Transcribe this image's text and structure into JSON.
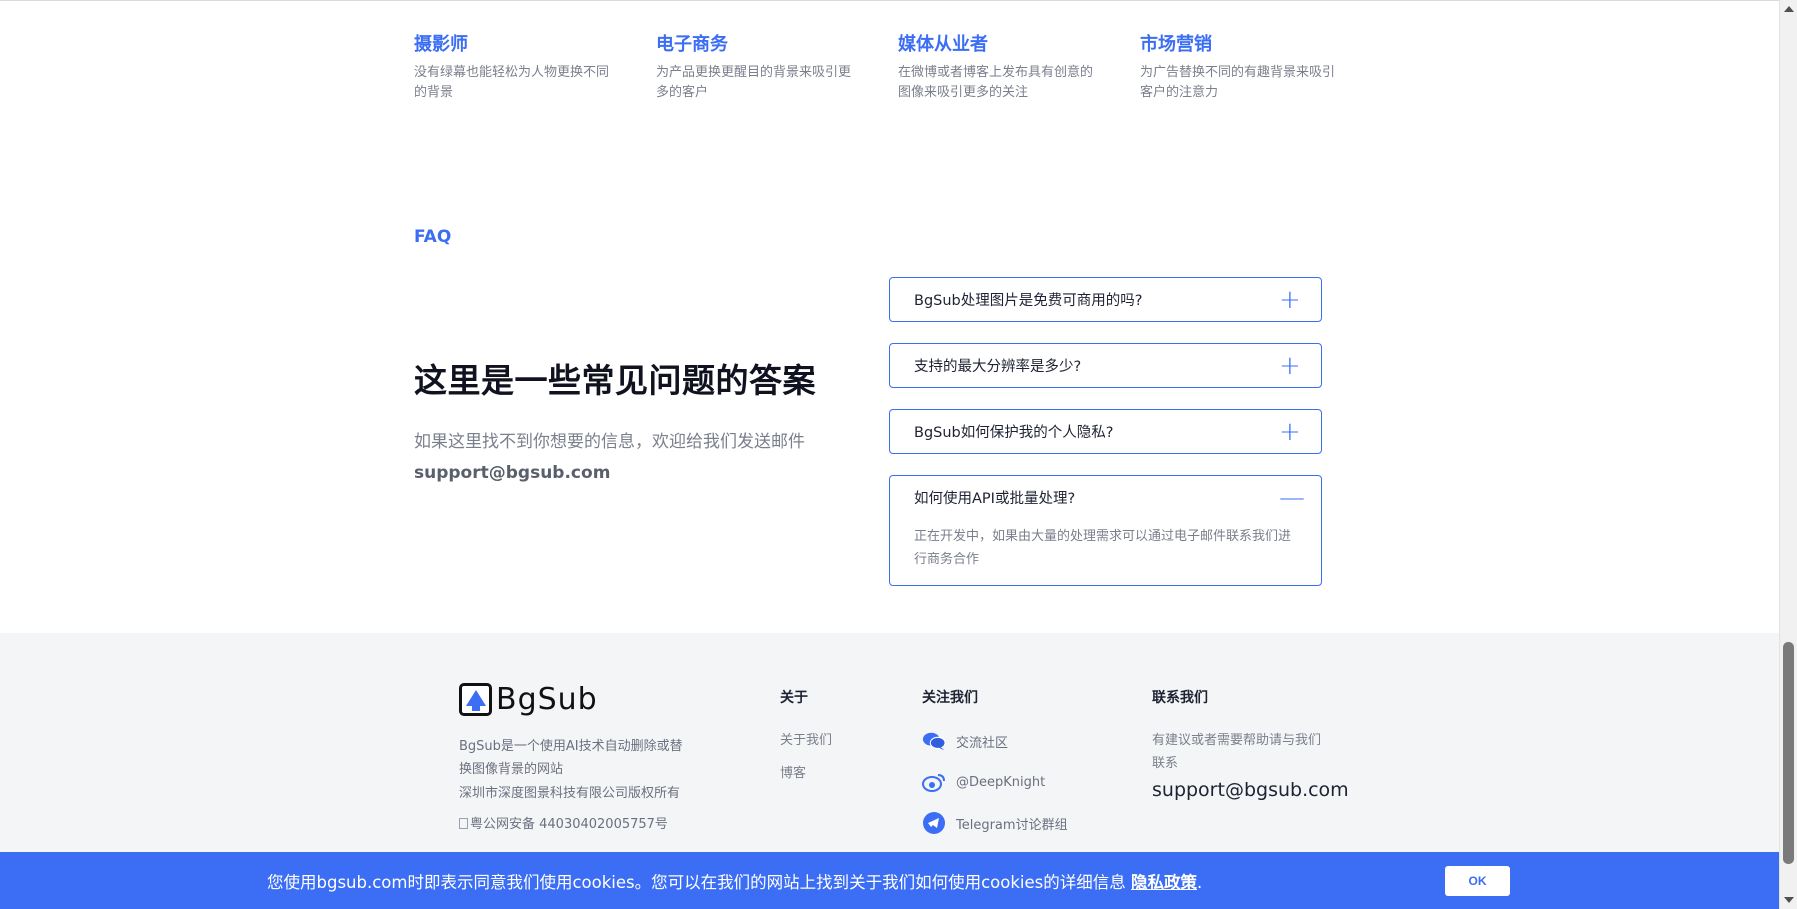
{
  "usecases": [
    {
      "title": "摄影师",
      "desc": "没有绿幕也能轻松为人物更换不同的背景"
    },
    {
      "title": "电子商务",
      "desc": "为产品更换更醒目的背景来吸引更多的客户"
    },
    {
      "title": "媒体从业者",
      "desc": "在微博或者博客上发布具有创意的图像来吸引更多的关注"
    },
    {
      "title": "市场营销",
      "desc": "为广告替换不同的有趣背景来吸引客户的注意力"
    }
  ],
  "faq": {
    "tag": "FAQ",
    "heading": "这里是一些常见问题的答案",
    "sub": "如果这里找不到你想要的信息，欢迎给我们发送邮件",
    "email": "support@bgsub.com",
    "items": [
      {
        "q": "BgSub处理图片是免费可商用的吗?",
        "toggle": "+",
        "expanded": false
      },
      {
        "q": "支持的最大分辨率是多少?",
        "toggle": "+",
        "expanded": false
      },
      {
        "q": "BgSub如何保护我的个人隐私?",
        "toggle": "+",
        "expanded": false
      },
      {
        "q": "如何使用API或批量处理?",
        "toggle": "—",
        "expanded": true,
        "a": "正在开发中，如果由大量的处理需求可以通过电子邮件联系我们进行商务合作"
      }
    ]
  },
  "footer": {
    "logo_text": "BgSub",
    "desc": "BgSub是一个使用AI技术自动删除或替换图像背景的网站",
    "copyright": "深圳市深度图景科技有限公司版权所有",
    "icp": "粤公网安备 44030402005757号",
    "about": {
      "title": "关于",
      "links": [
        "关于我们",
        "博客"
      ]
    },
    "follow": {
      "title": "关注我们",
      "items": [
        {
          "icon": "chat-icon",
          "label": "交流社区"
        },
        {
          "icon": "weibo-icon",
          "label": "@DeepKnight"
        },
        {
          "icon": "telegram-icon",
          "label": "Telegram讨论群组"
        }
      ]
    },
    "contact": {
      "title": "联系我们",
      "text": "有建议或者需要帮助请与我们联系",
      "email": "support@bgsub.com"
    }
  },
  "cookie": {
    "text": "您使用bgsub.com时即表示同意我们使用cookies。您可以在我们的网站上找到关于我们如何使用cookies的详细信息",
    "policy": "隐私政策",
    "period": ".",
    "ok": "OK"
  },
  "colors": {
    "accent": "#3b6ef5",
    "footer_bg": "#f4f5f6"
  }
}
